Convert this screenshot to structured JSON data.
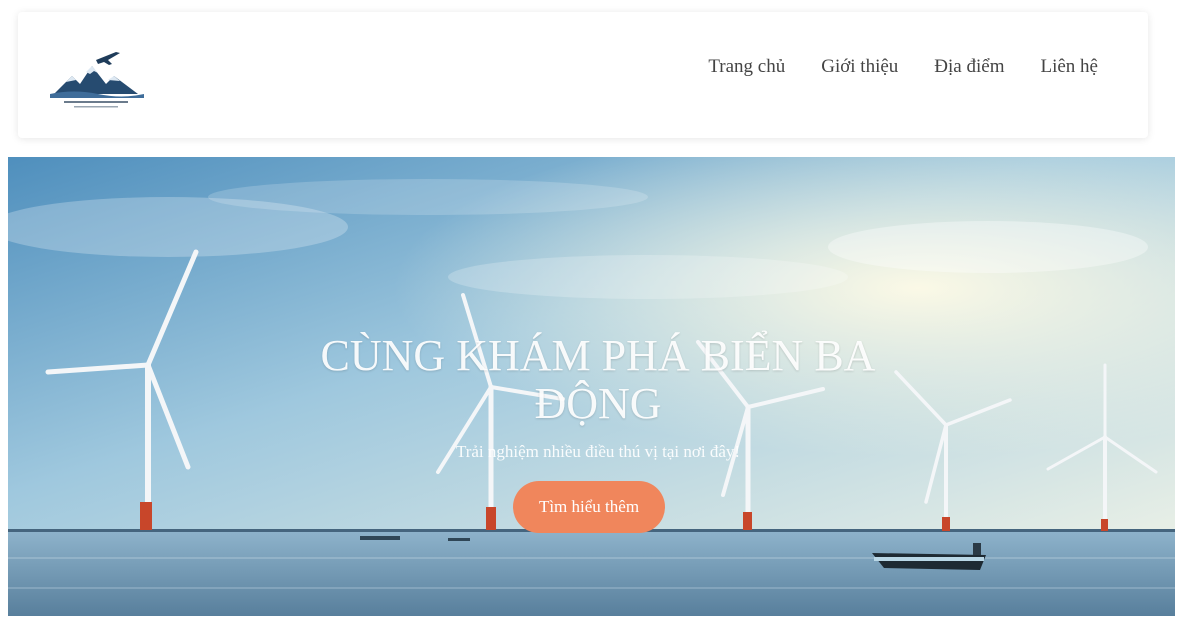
{
  "nav": {
    "items": [
      {
        "label": "Trang chủ"
      },
      {
        "label": "Giới thiệu"
      },
      {
        "label": "Địa điểm"
      },
      {
        "label": "Liên hệ"
      }
    ]
  },
  "hero": {
    "title": "CÙNG KHÁM PHÁ BIỂN BA ĐỘNG",
    "subtitle": "Trải nghiệm nhiều điều thú vị tại nơi đây!",
    "cta": "Tìm hiểu thêm"
  },
  "colors": {
    "cta_bg": "#f0865c",
    "nav_text": "#444444",
    "header_bg": "#ffffff"
  }
}
